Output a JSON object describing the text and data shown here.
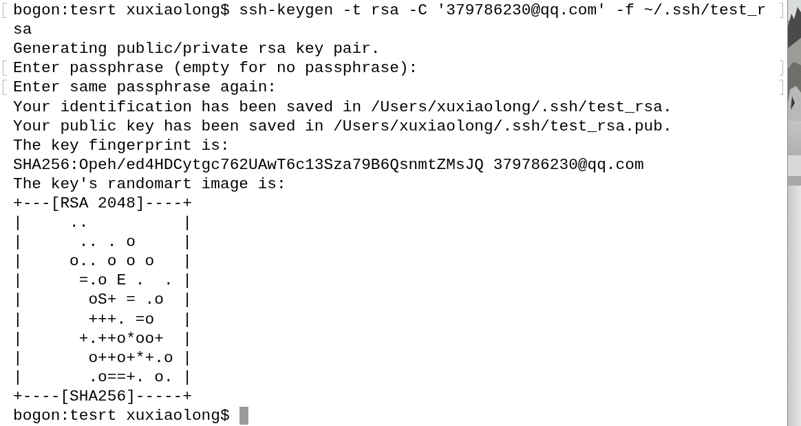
{
  "terminal": {
    "lines": [
      {
        "text": "bogon:tesrt xuxiaolong$ ssh-keygen -t rsa -C '379786230@qq.com' -f ~/.ssh/test_r",
        "marked": true
      },
      {
        "text": "sa",
        "marked": false
      },
      {
        "text": "Generating public/private rsa key pair.",
        "marked": false
      },
      {
        "text": "Enter passphrase (empty for no passphrase):",
        "marked": true
      },
      {
        "text": "Enter same passphrase again:",
        "marked": true
      },
      {
        "text": "Your identification has been saved in /Users/xuxiaolong/.ssh/test_rsa.",
        "marked": false
      },
      {
        "text": "Your public key has been saved in /Users/xuxiaolong/.ssh/test_rsa.pub.",
        "marked": false
      },
      {
        "text": "The key fingerprint is:",
        "marked": false
      },
      {
        "text": "SHA256:Opeh/ed4HDCytgc762UAwT6c13Sza79B6QsnmtZMsJQ 379786230@qq.com",
        "marked": false
      },
      {
        "text": "The key's randomart image is:",
        "marked": false
      },
      {
        "text": "+---[RSA 2048]----+",
        "marked": false
      },
      {
        "text": "|     ..          |",
        "marked": false
      },
      {
        "text": "|      .. . o     |",
        "marked": false
      },
      {
        "text": "|     o.. o o o   |",
        "marked": false
      },
      {
        "text": "|      =.o E .  . |",
        "marked": false
      },
      {
        "text": "|       oS+ = .o  |",
        "marked": false
      },
      {
        "text": "|       +++. =o   |",
        "marked": false
      },
      {
        "text": "|      +.++o*oo+  |",
        "marked": false
      },
      {
        "text": "|       o++o+*+.o |",
        "marked": false
      },
      {
        "text": "|       .o==+. o. |",
        "marked": false
      },
      {
        "text": "+----[SHA256]-----+",
        "marked": false
      }
    ],
    "prompt": "bogon:tesrt xuxiaolong$",
    "cursor": true
  }
}
